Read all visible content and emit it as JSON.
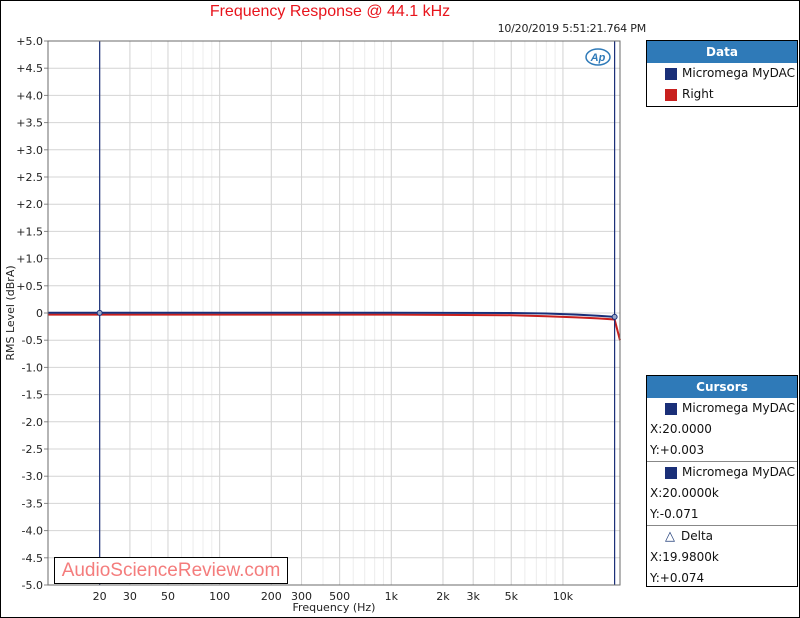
{
  "header": {
    "title": "Frequency Response @ 44.1 kHz",
    "timestamp": "10/20/2019 5:51:21.764 PM",
    "logo": "Ap"
  },
  "legend": {
    "title": "Data",
    "items": [
      {
        "label": "Micromega MyDAC",
        "color": "#1a2f78"
      },
      {
        "label": "Right",
        "color": "#c8201e"
      }
    ]
  },
  "cursors": {
    "title": "Cursors",
    "cursor1": {
      "label": "Micromega MyDAC",
      "color": "#1a2f78",
      "x": "X:20.0000",
      "y": "Y:+0.003"
    },
    "cursor2": {
      "label": "Micromega MyDAC",
      "color": "#1a2f78",
      "x": "X:20.0000k",
      "y": "Y:-0.071"
    },
    "delta": {
      "icon": "delta-icon",
      "label": "Delta",
      "x": "X:19.9800k",
      "y": "Y:+0.074"
    }
  },
  "watermark": "AudioScienceReview.com",
  "chart_data": {
    "type": "line",
    "title": "Frequency Response @ 44.1 kHz",
    "xlabel": "Frequency (Hz)",
    "ylabel": "RMS Level (dBrA)",
    "xscale": "log",
    "xlim": [
      10,
      21500
    ],
    "ylim": [
      -5.0,
      5.0
    ],
    "grid": true,
    "legend_position": "top-right (external panel)",
    "xticks": [
      {
        "value": 20,
        "label": "20"
      },
      {
        "value": 30,
        "label": "30"
      },
      {
        "value": 50,
        "label": "50"
      },
      {
        "value": 100,
        "label": "100"
      },
      {
        "value": 200,
        "label": "200"
      },
      {
        "value": 300,
        "label": "300"
      },
      {
        "value": 500,
        "label": "500"
      },
      {
        "value": 1000,
        "label": "1k"
      },
      {
        "value": 2000,
        "label": "2k"
      },
      {
        "value": 3000,
        "label": "3k"
      },
      {
        "value": 5000,
        "label": "5k"
      },
      {
        "value": 10000,
        "label": "10k"
      }
    ],
    "yticks": [
      {
        "value": 5.0,
        "label": "+5.0"
      },
      {
        "value": 4.5,
        "label": "+4.5"
      },
      {
        "value": 4.0,
        "label": "+4.0"
      },
      {
        "value": 3.5,
        "label": "+3.5"
      },
      {
        "value": 3.0,
        "label": "+3.0"
      },
      {
        "value": 2.5,
        "label": "+2.5"
      },
      {
        "value": 2.0,
        "label": "+2.0"
      },
      {
        "value": 1.5,
        "label": "+1.5"
      },
      {
        "value": 1.0,
        "label": "+1.0"
      },
      {
        "value": 0.5,
        "label": "+0.5"
      },
      {
        "value": 0,
        "label": "0"
      },
      {
        "value": -0.5,
        "label": "-0.5"
      },
      {
        "value": -1.0,
        "label": "-1.0"
      },
      {
        "value": -1.5,
        "label": "-1.5"
      },
      {
        "value": -2.0,
        "label": "-2.0"
      },
      {
        "value": -2.5,
        "label": "-2.5"
      },
      {
        "value": -3.0,
        "label": "-3.0"
      },
      {
        "value": -3.5,
        "label": "-3.5"
      },
      {
        "value": -4.0,
        "label": "-4.0"
      },
      {
        "value": -4.5,
        "label": "-4.5"
      },
      {
        "value": -5.0,
        "label": "-5.0"
      }
    ],
    "series": [
      {
        "name": "Micromega MyDAC",
        "color": "#1a2f78",
        "x": [
          10,
          20,
          100,
          1000,
          5000,
          8000,
          12000,
          16000,
          20000
        ],
        "y": [
          0.003,
          0.003,
          0.003,
          0.003,
          0.0,
          -0.01,
          -0.03,
          -0.05,
          -0.071
        ]
      },
      {
        "name": "Right",
        "color": "#c8201e",
        "x": [
          10,
          20,
          100,
          1000,
          5000,
          8000,
          12000,
          16000,
          20000,
          21500
        ],
        "y": [
          -0.03,
          -0.03,
          -0.03,
          -0.03,
          -0.04,
          -0.06,
          -0.08,
          -0.1,
          -0.12,
          -0.5
        ]
      }
    ],
    "cursors": [
      {
        "x": 20,
        "y": 0.003,
        "color": "#1a2f78"
      },
      {
        "x": 20000,
        "y": -0.071,
        "color": "#1a2f78"
      }
    ]
  }
}
